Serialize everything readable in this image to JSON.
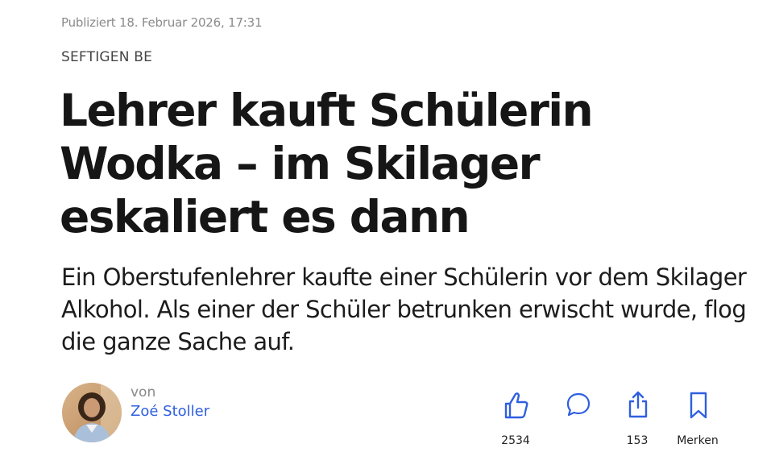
{
  "article": {
    "published": "Publiziert 18. Februar 2026, 17:31",
    "kicker": "SEFTIGEN BE",
    "title": "Lehrer kauft Schülerin Wodka – im Skilager eskaliert es dann",
    "lead": "Ein Oberstufenlehrer kaufte einer Schülerin vor dem Skilager Alkohol. Als einer der Schüler betrunken erwischt wurde, flog die ganze Sache auf."
  },
  "author": {
    "prefix": "von",
    "name": "Zoé Stoller"
  },
  "actions": {
    "like": {
      "icon": "thumbs-up-icon",
      "count": "2534"
    },
    "comment": {
      "icon": "speech-bubble-icon"
    },
    "share": {
      "icon": "share-icon",
      "count": "153"
    },
    "bookmark": {
      "icon": "bookmark-icon",
      "label": "Merken"
    }
  },
  "colors": {
    "accent": "#2f5fe0",
    "muted_text": "#8a8a8a",
    "headline": "#161616"
  }
}
